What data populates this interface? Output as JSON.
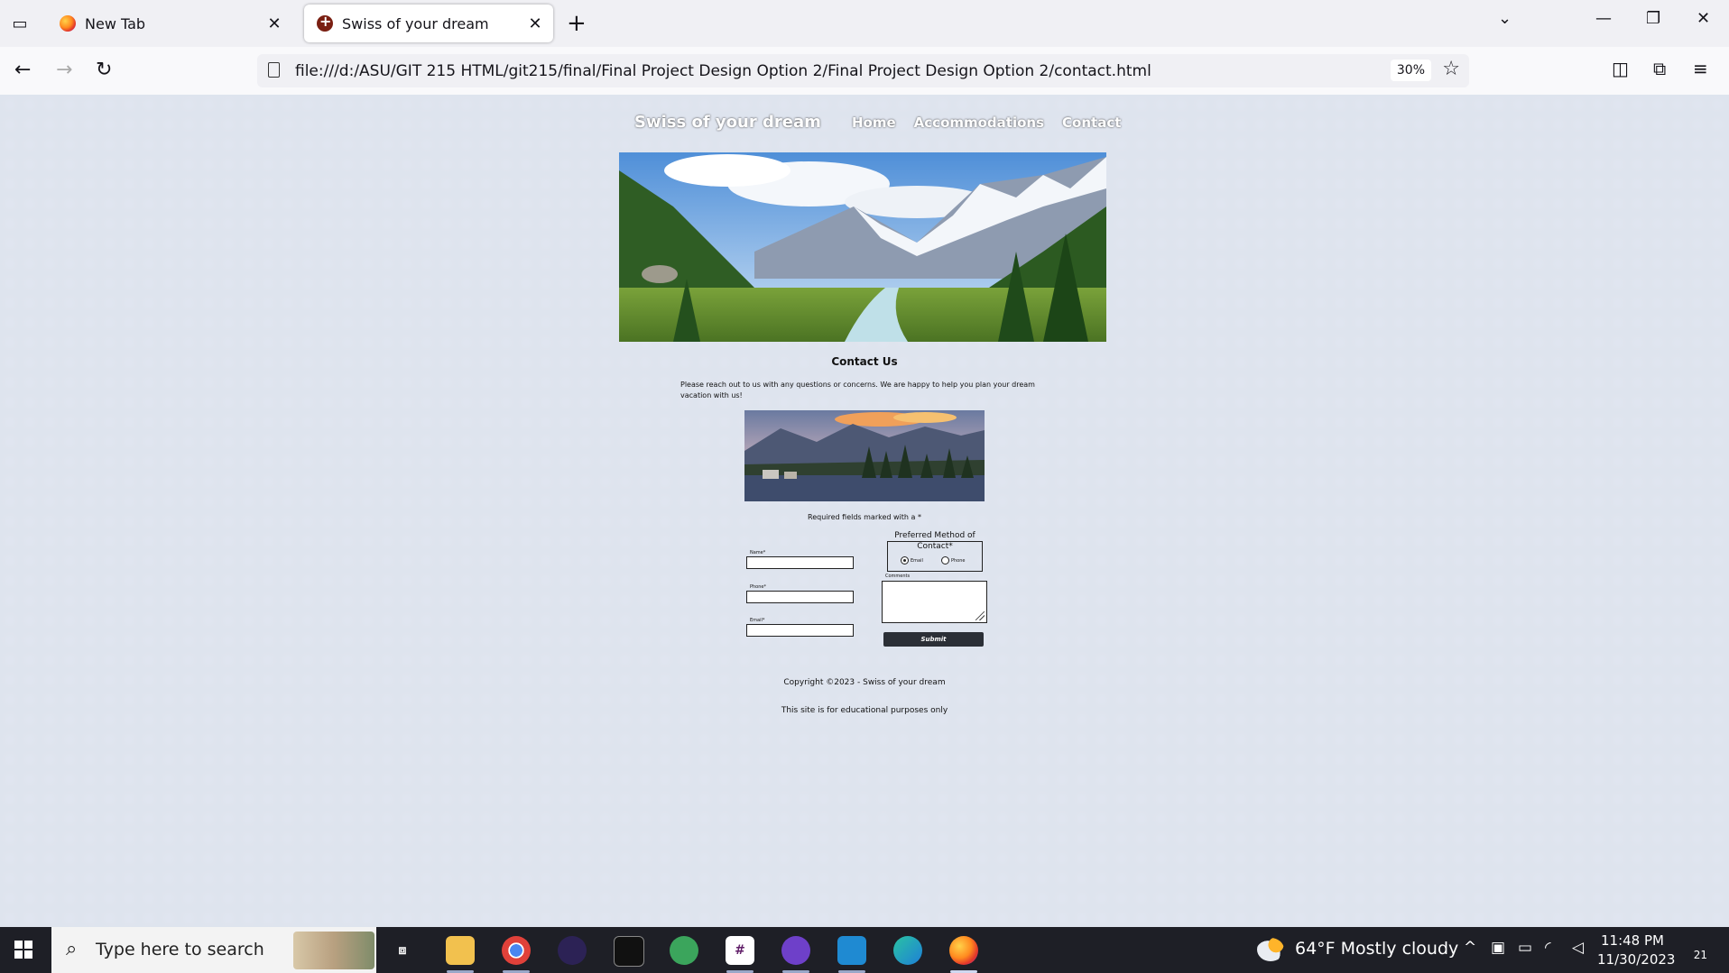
{
  "browser": {
    "tabs": [
      {
        "title": "New Tab",
        "active": false
      },
      {
        "title": "Swiss of your dream",
        "active": true
      }
    ],
    "url": "file:///d:/ASU/GIT 215 HTML/git215/final/Final Project Design Option 2/Final Project Design Option 2/contact.html",
    "zoom": "30%",
    "icons": {
      "tab_list": "tab-list-icon",
      "new_tab": "plus-icon",
      "list_all_tabs": "chevron-down-icon",
      "minimize": "minimize-icon",
      "restore": "restore-icon",
      "close": "close-icon",
      "back": "back-arrow-icon",
      "forward": "forward-arrow-icon",
      "reload": "reload-icon",
      "bookmark": "star-icon",
      "pocket": "pocket-icon",
      "extensions": "puzzle-icon",
      "menu": "hamburger-menu-icon"
    }
  },
  "site": {
    "title": "Swiss of your dream",
    "nav": [
      "Home",
      "Accommodations",
      "Contact"
    ],
    "contact_heading": "Contact Us",
    "intro": "Please reach out to us with any questions or concerns. We are happy to help you plan your dream vacation with us!",
    "required_note": "Required fields marked with a *",
    "form": {
      "field_labels": [
        "Name*",
        "Phone*",
        "Email*"
      ],
      "field_values": [
        "",
        "",
        ""
      ],
      "preferred_legend": "Preferred Method of Contact*",
      "radio_options": [
        "Email",
        "Phone"
      ],
      "radio_selected": "Email",
      "comments_label": "Comments",
      "comments_value": "",
      "submit_label": "Submit"
    },
    "footer": {
      "copyright": "Copyright ©2023 - Swiss of your dream",
      "note": "This site is for educational purposes only"
    }
  },
  "taskbar": {
    "search_placeholder": "Type here to search",
    "apps": [
      "task-view-icon",
      "file-explorer-icon",
      "chrome-icon",
      "eclipse-icon",
      "terminal-icon",
      "android-studio-icon",
      "slack-icon",
      "github-desktop-icon",
      "vscode-icon",
      "edge-icon",
      "firefox-icon"
    ],
    "weather": "64°F Mostly cloudy",
    "time": "11:48 PM",
    "date": "11/30/2023",
    "notification_count": "21"
  }
}
